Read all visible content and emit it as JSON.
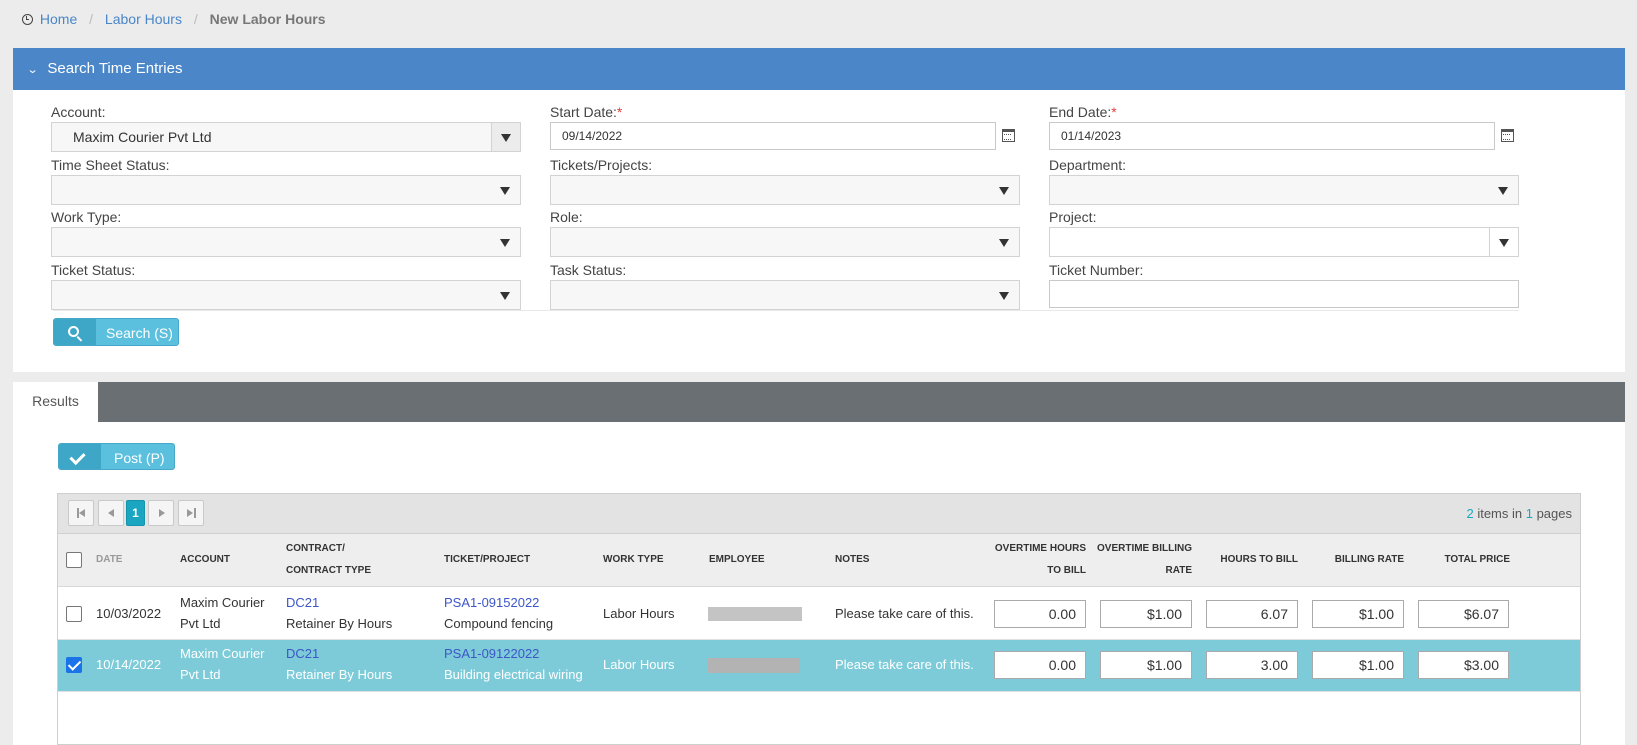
{
  "breadcrumb": {
    "home": "Home",
    "labor_hours": "Labor Hours",
    "current": "New Labor Hours",
    "sep": "/"
  },
  "search_panel": {
    "title": "Search Time Entries",
    "account_label": "Account:",
    "account_value": "Maxim Courier Pvt Ltd",
    "start_date_label": "Start Date:",
    "start_date_value": "09/14/2022",
    "end_date_label": "End Date:",
    "end_date_value": "01/14/2023",
    "required_mark": "*",
    "time_sheet_status_label": "Time Sheet Status:",
    "tickets_projects_label": "Tickets/Projects:",
    "department_label": "Department:",
    "work_type_label": "Work Type:",
    "role_label": "Role:",
    "project_label": "Project:",
    "ticket_status_label": "Ticket Status:",
    "task_status_label": "Task Status:",
    "ticket_number_label": "Ticket Number:",
    "search_button": "Search (S)"
  },
  "results": {
    "tab": "Results",
    "post_button": "Post (P)",
    "pager": {
      "current_page": "1",
      "items": "2",
      "items_text": " items in ",
      "pages": "1",
      "pages_text": " pages"
    },
    "columns": {
      "date": "DATE",
      "account": "ACCOUNT",
      "contract_1": "CONTRACT/",
      "contract_2": "CONTRACT TYPE",
      "ticket": "TICKET/PROJECT",
      "work_type": "WORK TYPE",
      "employee": "EMPLOYEE",
      "notes": "NOTES",
      "ot_hours_1": "OVERTIME HOURS",
      "ot_hours_2": "TO BILL",
      "ot_rate_1": "OVERTIME BILLING",
      "ot_rate_2": "RATE",
      "hours_to_bill": "HOURS TO BILL",
      "billing_rate": "BILLING RATE",
      "total_price": "TOTAL PRICE"
    },
    "rows": [
      {
        "checked": false,
        "date": "10/03/2022",
        "account_1": "Maxim Courier",
        "account_2": "Pvt Ltd",
        "contract": "DC21",
        "contract_type": "Retainer By Hours",
        "ticket": "PSA1-09152022",
        "ticket_name": "Compound fencing",
        "work_type": "Labor Hours",
        "notes": "Please take care of this.",
        "ot_hours": "0.00",
        "ot_rate": "$1.00",
        "hours": "6.07",
        "rate": "$1.00",
        "total": "$6.07"
      },
      {
        "checked": true,
        "date": "10/14/2022",
        "account_1": "Maxim Courier",
        "account_2": "Pvt Ltd",
        "contract": "DC21",
        "contract_type": "Retainer By Hours",
        "ticket": "PSA1-09122022",
        "ticket_name": "Building electrical wiring",
        "work_type": "Labor Hours",
        "notes": "Please take care of this.",
        "ot_hours": "0.00",
        "ot_rate": "$1.00",
        "hours": "3.00",
        "rate": "$1.00",
        "total": "$3.00"
      }
    ]
  },
  "colors": {
    "header_blue": "#4a86c8",
    "accent_teal": "#5bc0de",
    "selected_row": "#7dcbd9",
    "link": "#3d56c8",
    "required": "#e04040"
  }
}
